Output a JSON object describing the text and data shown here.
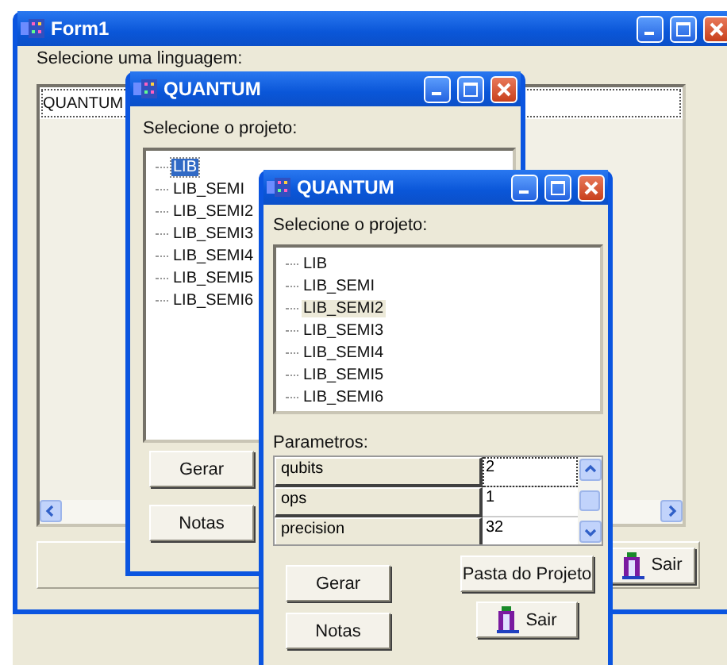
{
  "windows": [
    {
      "title": "Form1",
      "prompt": "Selecione uma linguagem:",
      "languages": [
        {
          "label": "QUANTUM",
          "selected": true
        }
      ],
      "buttons": [
        {
          "label": "Sair",
          "kind": "exit"
        }
      ]
    },
    {
      "title": "QUANTUM",
      "prompt": "Selecione o projeto:",
      "tree_focused": true,
      "projects": [
        {
          "label": "LIB",
          "selected": true
        },
        {
          "label": "LIB_SEMI",
          "selected": false
        },
        {
          "label": "LIB_SEMI2",
          "selected": false
        },
        {
          "label": "LIB_SEMI3",
          "selected": false
        },
        {
          "label": "LIB_SEMI4",
          "selected": false
        },
        {
          "label": "LIB_SEMI5",
          "selected": false
        },
        {
          "label": "LIB_SEMI6",
          "selected": false
        }
      ],
      "buttons": [
        {
          "label": "Gerar",
          "kind": "plain"
        },
        {
          "label": "Notas",
          "kind": "plain"
        }
      ]
    },
    {
      "title": "QUANTUM",
      "prompt": "Selecione o projeto:",
      "tree_focused": false,
      "projects": [
        {
          "label": "LIB",
          "selected": false
        },
        {
          "label": "LIB_SEMI",
          "selected": false
        },
        {
          "label": "LIB_SEMI2",
          "selected": true
        },
        {
          "label": "LIB_SEMI3",
          "selected": false
        },
        {
          "label": "LIB_SEMI4",
          "selected": false
        },
        {
          "label": "LIB_SEMI5",
          "selected": false
        },
        {
          "label": "LIB_SEMI6",
          "selected": false
        }
      ],
      "parameters_label": "Parametros:",
      "parameters": [
        {
          "name": "qubits",
          "value": "2",
          "selected": true
        },
        {
          "name": "ops",
          "value": "1",
          "selected": false
        },
        {
          "name": "precision",
          "value": "32",
          "selected": false
        }
      ],
      "buttons": [
        {
          "label": "Gerar",
          "kind": "plain"
        },
        {
          "label": "Notas",
          "kind": "plain"
        },
        {
          "label": "Pasta do Projeto",
          "kind": "plain"
        },
        {
          "label": "Sair",
          "kind": "exit"
        }
      ]
    }
  ]
}
